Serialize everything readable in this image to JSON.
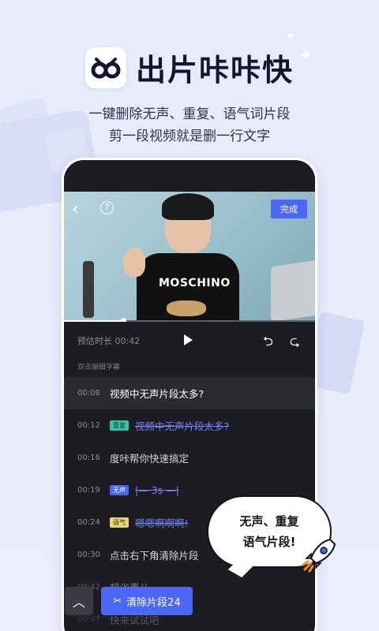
{
  "header": {
    "app_title": "出片咔咔快",
    "subtitle_line1": "一键删除无声、重复、语气词片段",
    "subtitle_line2": "剪一段视频就是删一行文字"
  },
  "video": {
    "done_label": "完成",
    "shirt_text": "MOSCHINO",
    "progress_fraction": 0.24
  },
  "controls": {
    "duration_label": "预估时长 00:42",
    "hint": "双击编辑字幕"
  },
  "subtitles": [
    {
      "time": "00:08",
      "text": "视频中无声片段太多?",
      "tag": "",
      "struck": false
    },
    {
      "time": "00:12",
      "text": "视频中无声片段太多?",
      "tag": "重复",
      "struck": true
    },
    {
      "time": "00:16",
      "text": "度咔帮你快速搞定",
      "tag": "",
      "struck": false
    },
    {
      "time": "00:19",
      "text": "|—  3s  —|",
      "tag": "无声",
      "struck": true
    },
    {
      "time": "00:24",
      "text": "嗯嗯啊啊啊!",
      "tag": "语气",
      "struck": true
    },
    {
      "time": "00:30",
      "text": "点击右下角清除片段",
      "tag": "",
      "struck": false
    },
    {
      "time": "00:42",
      "text": "超省事儿",
      "tag": "",
      "struck": false
    },
    {
      "time": "00:47",
      "text": "快来试试吧",
      "tag": "",
      "struck": false
    }
  ],
  "bottom": {
    "up_icon": "chevron-up-icon",
    "clear_label": "清除片段24"
  },
  "bubble": {
    "line1": "无声、重复",
    "line2": "语气片段!"
  },
  "colors": {
    "accent": "#4c67f5",
    "background": "#e7ebfb",
    "screen": "#1c1c22"
  }
}
